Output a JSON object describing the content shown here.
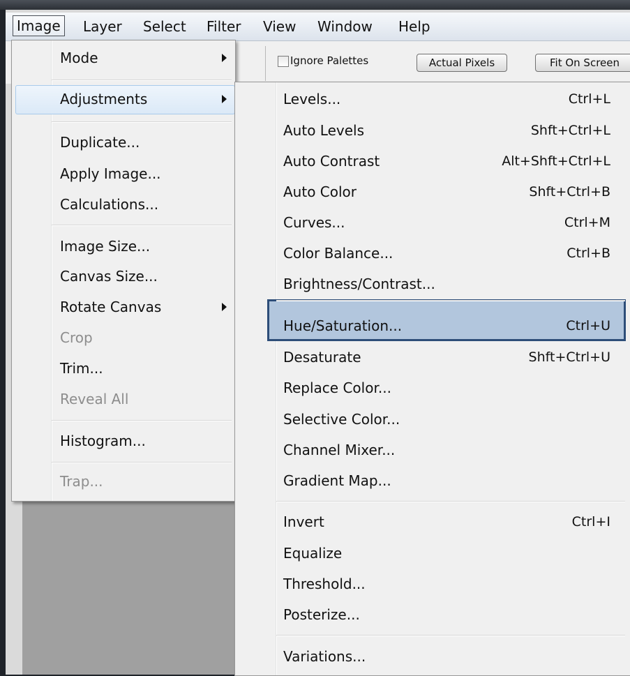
{
  "menubar": {
    "items": [
      "Image",
      "Layer",
      "Select",
      "Filter",
      "View",
      "Window",
      "Help"
    ]
  },
  "options_bar": {
    "ignore_palettes_label": "Ignore Palettes",
    "actual_pixels_label": "Actual Pixels",
    "fit_on_screen_label": "Fit On Screen"
  },
  "image_menu": {
    "items": [
      {
        "label": "Mode",
        "submenu": true
      },
      {
        "label": "Adjustments",
        "submenu": true,
        "highlighted": true
      },
      {
        "label": "Duplicate..."
      },
      {
        "label": "Apply Image..."
      },
      {
        "label": "Calculations..."
      },
      {
        "label": "Image Size..."
      },
      {
        "label": "Canvas Size..."
      },
      {
        "label": "Rotate Canvas",
        "submenu": true
      },
      {
        "label": "Crop",
        "disabled": true
      },
      {
        "label": "Trim..."
      },
      {
        "label": "Reveal All",
        "disabled": true
      },
      {
        "label": "Histogram..."
      },
      {
        "label": "Trap...",
        "disabled": true
      }
    ]
  },
  "adjustments_menu": {
    "items": [
      {
        "label": "Levels...",
        "shortcut": "Ctrl+L"
      },
      {
        "label": "Auto Levels",
        "shortcut": "Shft+Ctrl+L"
      },
      {
        "label": "Auto Contrast",
        "shortcut": "Alt+Shft+Ctrl+L"
      },
      {
        "label": "Auto Color",
        "shortcut": "Shft+Ctrl+B"
      },
      {
        "label": "Curves...",
        "shortcut": "Ctrl+M"
      },
      {
        "label": "Color Balance...",
        "shortcut": "Ctrl+B"
      },
      {
        "label": "Brightness/Contrast...",
        "shortcut": ""
      },
      {
        "label": "Hue/Saturation...",
        "shortcut": "Ctrl+U",
        "highlighted": true
      },
      {
        "label": "Desaturate",
        "shortcut": "Shft+Ctrl+U"
      },
      {
        "label": "Replace Color...",
        "shortcut": ""
      },
      {
        "label": "Selective Color...",
        "shortcut": ""
      },
      {
        "label": "Channel Mixer...",
        "shortcut": ""
      },
      {
        "label": "Gradient Map...",
        "shortcut": ""
      },
      {
        "label": "Invert",
        "shortcut": "Ctrl+I"
      },
      {
        "label": "Equalize",
        "shortcut": ""
      },
      {
        "label": "Threshold...",
        "shortcut": ""
      },
      {
        "label": "Posterize...",
        "shortcut": ""
      },
      {
        "label": "Variations...",
        "shortcut": ""
      }
    ]
  },
  "colors": {
    "highlight_border": "#2d4d78",
    "highlight_fill": "#b2c6dd",
    "hover_fill": "#dbe9f7",
    "menu_bg": "#f0f0f0",
    "canvas_bg": "#a0a0a0"
  }
}
